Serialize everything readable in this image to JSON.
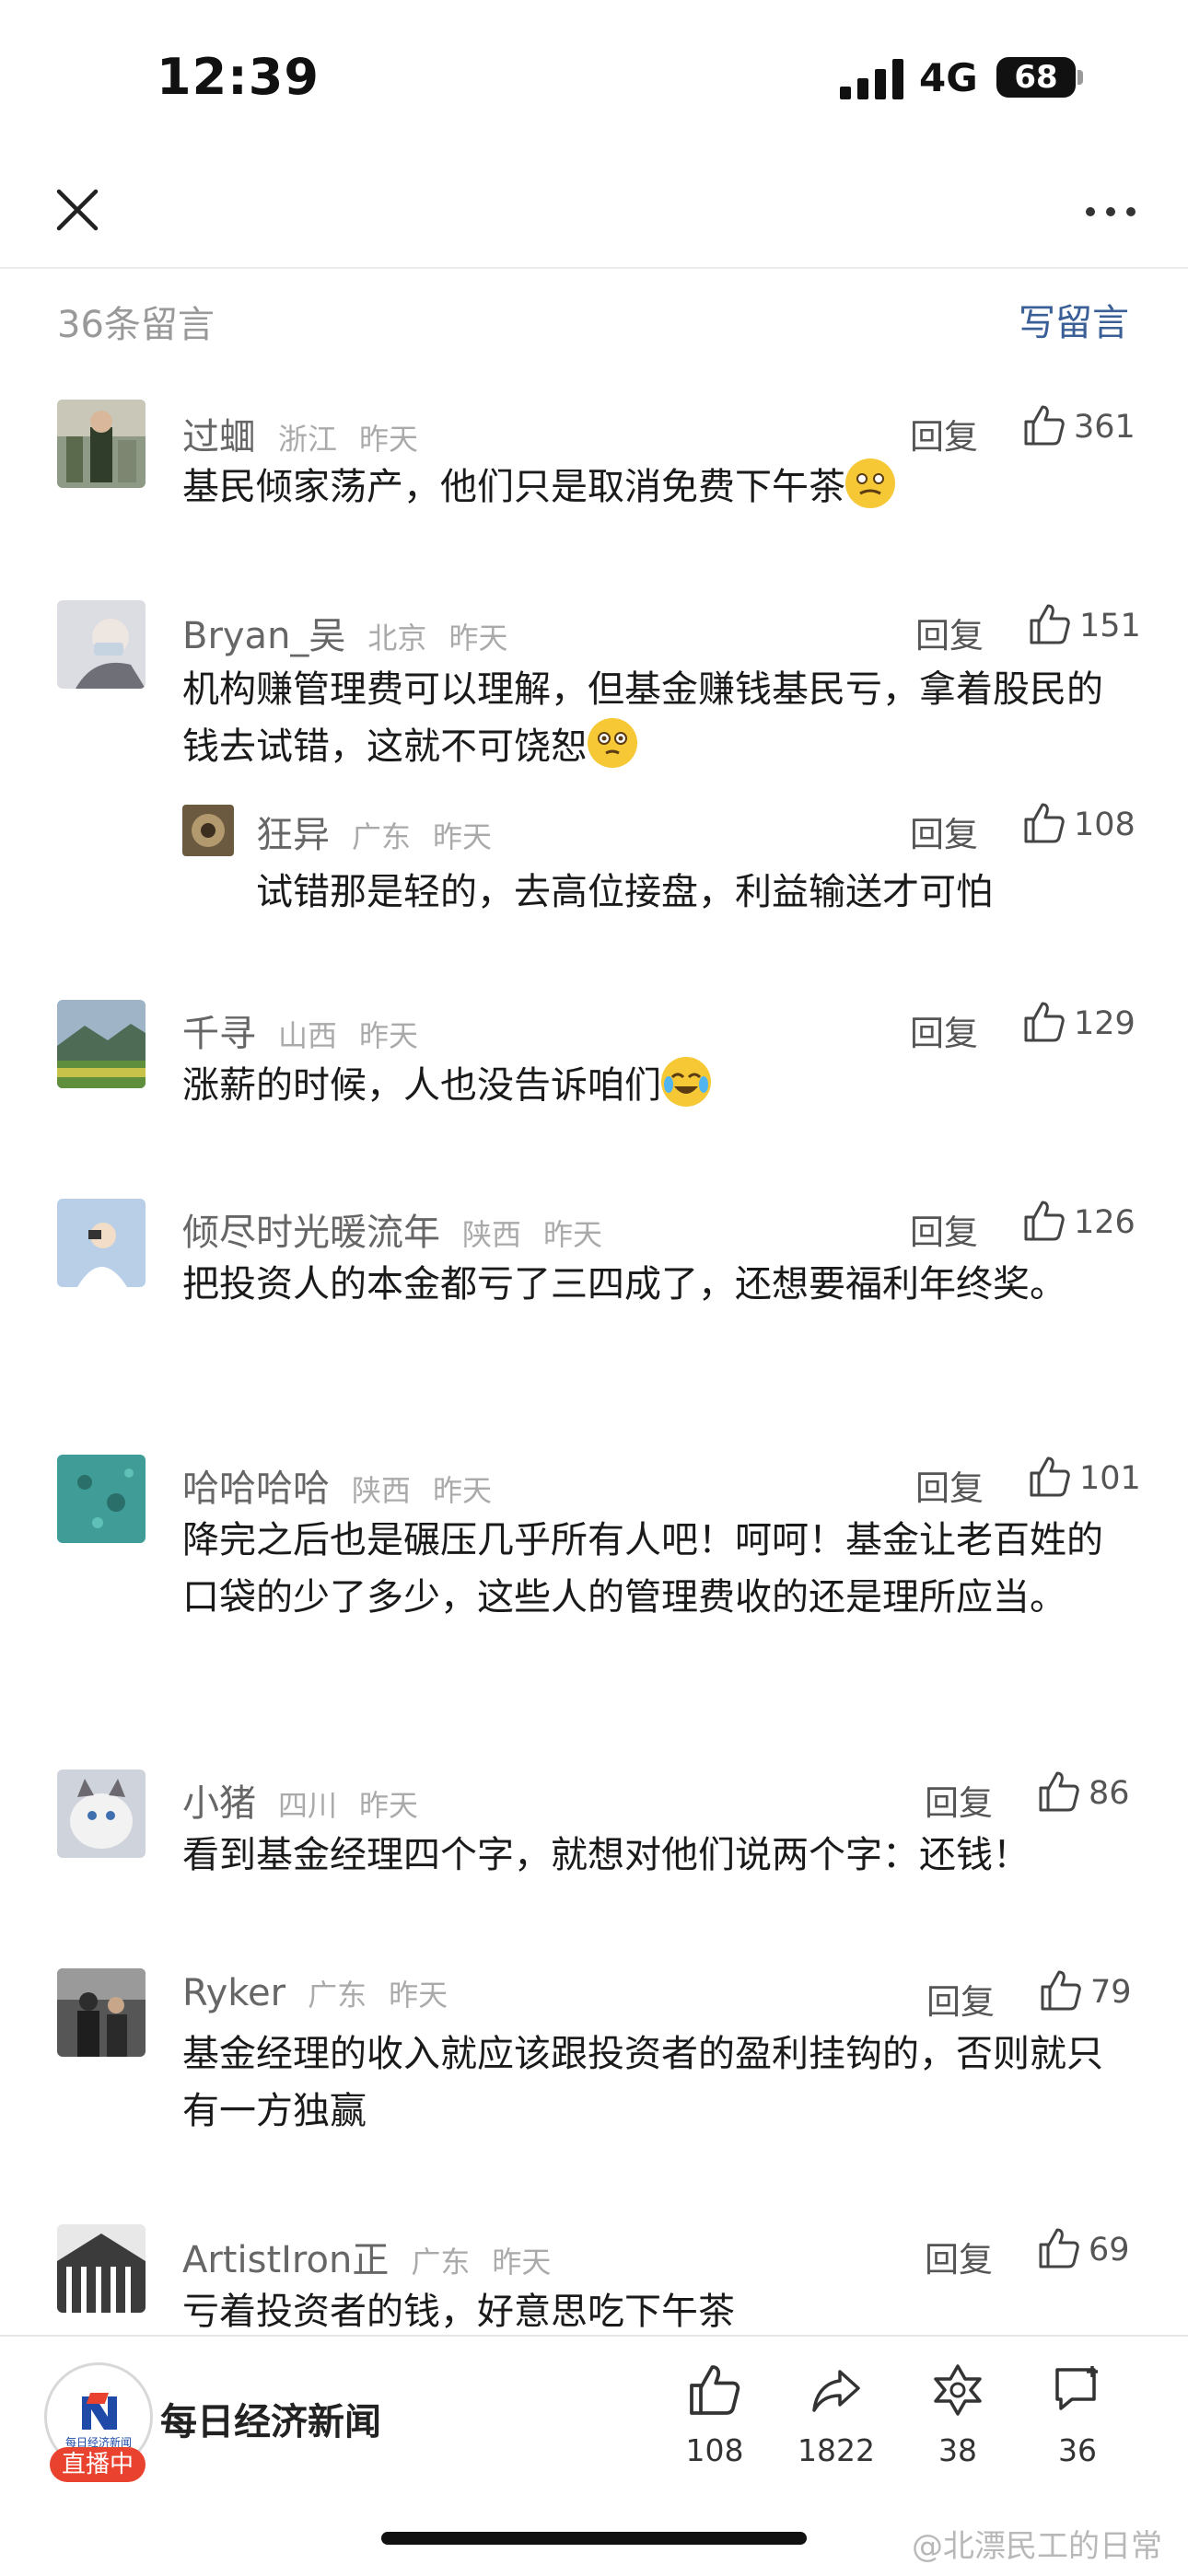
{
  "status": {
    "time": "12:39",
    "network": "4G",
    "battery": "68"
  },
  "header": {
    "count_label": "36条留言",
    "write_label": "写留言"
  },
  "reply_label": "回复",
  "comments": [
    {
      "name": "过蜖",
      "region": "浙江",
      "time": "昨天",
      "likes": "361",
      "text": "基民倾家荡产，他们只是取消免费下午茶"
    },
    {
      "name": "Bryan_吴",
      "region": "北京",
      "time": "昨天",
      "likes": "151",
      "text": "机构赚管理费可以理解，但基金赚钱基民亏，拿着股民的钱去试错，这就不可饶恕",
      "sub": {
        "name": "狂异",
        "region": "广东",
        "time": "昨天",
        "likes": "108",
        "text": "试错那是轻的，去高位接盘，利益输送才可怕"
      }
    },
    {
      "name": "千寻",
      "region": "山西",
      "time": "昨天",
      "likes": "129",
      "text": "涨薪的时候，人也没告诉咱们"
    },
    {
      "name": "倾尽时光暖流年",
      "region": "陕西",
      "time": "昨天",
      "likes": "126",
      "text": "把投资人的本金都亏了三四成了，还想要福利年终奖。"
    },
    {
      "name": "哈哈哈哈",
      "region": "陕西",
      "time": "昨天",
      "likes": "101",
      "text": "降完之后也是碾压几乎所有人吧！呵呵！基金让老百姓的口袋的少了多少，这些人的管理费收的还是理所应当。"
    },
    {
      "name": "小猪",
      "region": "四川",
      "time": "昨天",
      "likes": "86",
      "text": "看到基金经理四个字，就想对他们说两个字：还钱！"
    },
    {
      "name": "Ryker",
      "region": "广东",
      "time": "昨天",
      "likes": "79",
      "text": "基金经理的收入就应该跟投资者的盈利挂钩的，否则就只有一方独赢"
    },
    {
      "name": "ArtistIron正",
      "region": "广东",
      "time": "昨天",
      "likes": "69",
      "text": "亏着投资者的钱，好意思吃下午茶"
    }
  ],
  "bottom": {
    "brand": "每日经济新闻",
    "logo_text": "每日经济新闻",
    "live_badge": "直播中",
    "like_count": "108",
    "share_count": "1822",
    "favorite_count": "38",
    "comment_count": "36"
  },
  "watermark": "@北漂民工的日常"
}
